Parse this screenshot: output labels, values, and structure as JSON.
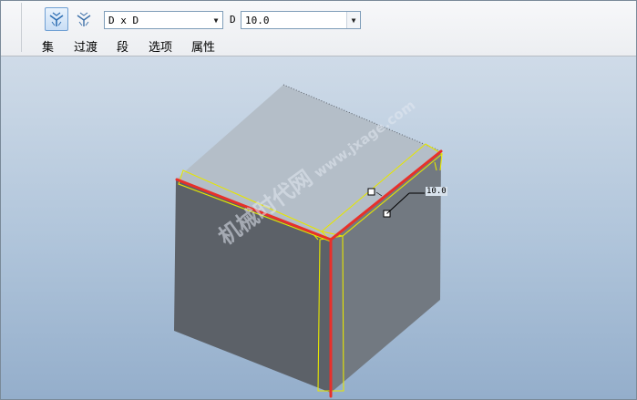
{
  "toolbar": {
    "icons": [
      "chamfer-edge-icon",
      "chamfer-transition-icon"
    ],
    "scheme_select": {
      "value": "D x D"
    },
    "d_label": "D",
    "d_value_select": {
      "value": "10.0"
    }
  },
  "tabs": [
    {
      "label": "集"
    },
    {
      "label": "过渡"
    },
    {
      "label": "段"
    },
    {
      "label": "选项"
    },
    {
      "label": "属性"
    }
  ],
  "viewport": {
    "dimension_label": "10.0",
    "watermark": {
      "text": "机械时代网",
      "url": "www.jxage.com"
    },
    "colors": {
      "cube_top": "#b4bec8",
      "cube_left": "#5c6168",
      "cube_right": "#727981",
      "selected_edge": "#e8302a",
      "preview_outline": "#e6e600"
    }
  }
}
